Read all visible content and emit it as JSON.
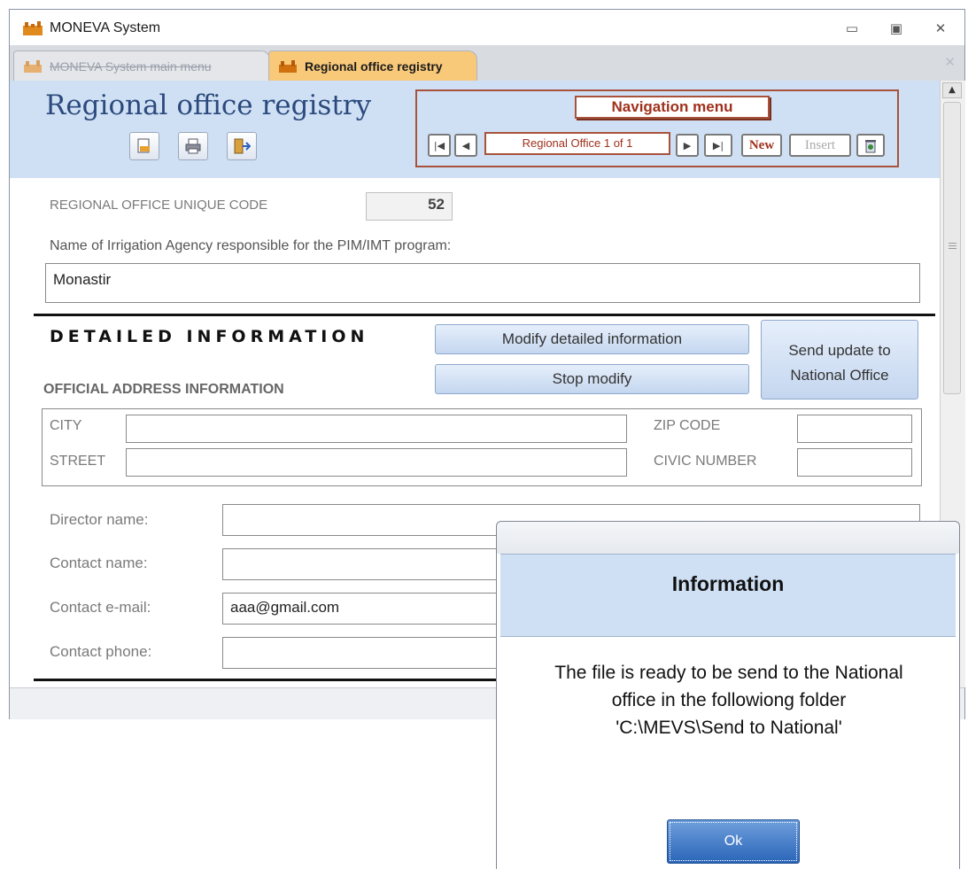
{
  "window": {
    "title": "MONEVA System"
  },
  "tabs": [
    {
      "label": "MONEVA System main menu"
    },
    {
      "label": "Regional office registry"
    }
  ],
  "form": {
    "title": "Regional office registry",
    "navigation": {
      "title": "Navigation menu",
      "record": "Regional Office 1 of 1",
      "new_label": "New",
      "insert_label": "Insert"
    }
  },
  "fields": {
    "unique_code_label": "REGIONAL OFFICE UNIQUE CODE",
    "unique_code_value": "52",
    "agency_label": "Name of Irrigation Agency responsible for the PIM/IMT program:",
    "agency_value": "Monastir"
  },
  "detailed": {
    "heading": "DETAILED INFORMATION",
    "modify_label": "Modify detailed information",
    "stop_label": "Stop modify",
    "send_label_line1": "Send update to",
    "send_label_line2": "National Office",
    "address_heading": "OFFICIAL ADDRESS INFORMATION",
    "city_label": "CITY",
    "zip_label": "ZIP CODE",
    "street_label": "STREET",
    "civic_label": "CIVIC NUMBER",
    "city_value": "",
    "zip_value": "",
    "street_value": "",
    "civic_value": ""
  },
  "contacts": {
    "director_label": "Director name:",
    "contact_label": "Contact name:",
    "email_label": "Contact e-mail:",
    "phone_label": "Contact phone:",
    "director_value": "",
    "contact_value": "",
    "email_value": "aaa@gmail.com",
    "phone_value": ""
  },
  "dialog": {
    "title": "Information",
    "message_line1": "The file is ready to be send to the National",
    "message_line2": "office in the followiong folder",
    "message_line3": "'C:\\MEVS\\Send to National'",
    "ok_label": "Ok"
  },
  "colors": {
    "header_bg": "#cfe0f5",
    "nav_border": "#a8523c",
    "active_tab": "#f9c97a",
    "ok_button": "#2a65b8"
  }
}
